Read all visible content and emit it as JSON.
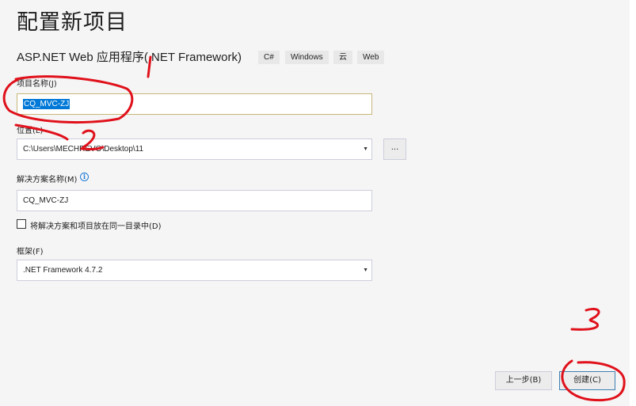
{
  "header": {
    "title": "配置新项目",
    "template_name": "ASP.NET Web 应用程序(.NET Framework)",
    "tags": [
      "C#",
      "Windows",
      "云",
      "Web"
    ]
  },
  "form": {
    "project_name_label": "项目名称(J)",
    "project_name_value": "CQ_MVC-ZJ",
    "location_label": "位置(L)",
    "location_value": "C:\\Users\\MECHREVO\\Desktop\\11",
    "browse_label": "...",
    "solution_name_label": "解决方案名称(M)",
    "solution_name_value": "CQ_MVC-ZJ",
    "same_dir_checkbox_label": "将解决方案和项目放在同一目录中(D)",
    "same_dir_checked": false,
    "framework_label": "框架(F)",
    "framework_value": ".NET Framework 4.7.2"
  },
  "footer": {
    "back_button": "上一步(B)",
    "create_button": "创建(C)"
  },
  "icons": {
    "info": "info-icon",
    "dropdown": "chevron-down-icon"
  },
  "colors": {
    "selection": "#0078d7",
    "annotation": "#e0111b",
    "info": "#1e7bd6"
  }
}
